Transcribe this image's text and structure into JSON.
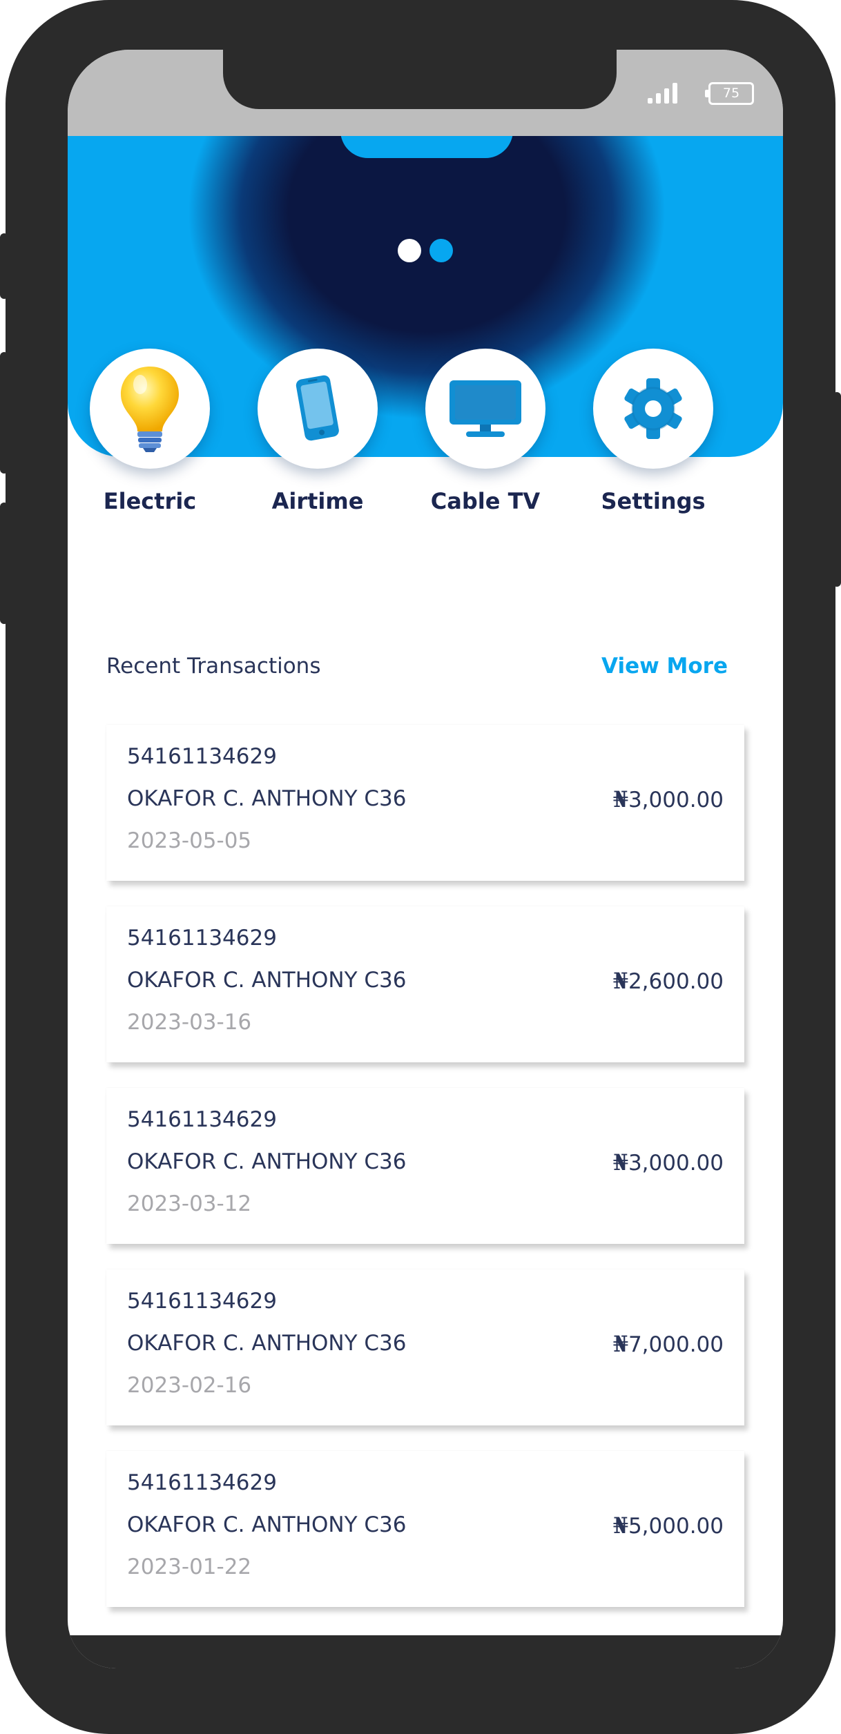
{
  "status_bar": {
    "battery_level": "75",
    "signal_bars": 4
  },
  "carousel": {
    "page_count": 2,
    "active_index": 1
  },
  "services": [
    {
      "label": "Electric",
      "icon": "lightbulb-icon"
    },
    {
      "label": "Airtime",
      "icon": "smartphone-icon"
    },
    {
      "label": "Cable TV",
      "icon": "tv-monitor-icon"
    },
    {
      "label": "Settings",
      "icon": "gear-icon"
    }
  ],
  "transactions_section": {
    "title": "Recent Transactions",
    "view_more_label": "View More"
  },
  "currency_symbol": "₦",
  "transactions": [
    {
      "account": "54161134629",
      "name": "OKAFOR C. ANTHONY C36",
      "date": "2023-05-05",
      "amount": "3,000.00"
    },
    {
      "account": "54161134629",
      "name": "OKAFOR C. ANTHONY C36",
      "date": "2023-03-16",
      "amount": "2,600.00"
    },
    {
      "account": "54161134629",
      "name": "OKAFOR C. ANTHONY C36",
      "date": "2023-03-12",
      "amount": "3,000.00"
    },
    {
      "account": "54161134629",
      "name": "OKAFOR C. ANTHONY C36",
      "date": "2023-02-16",
      "amount": "7,000.00"
    },
    {
      "account": "54161134629",
      "name": "OKAFOR C. ANTHONY C36",
      "date": "2023-01-22",
      "amount": "5,000.00"
    }
  ],
  "colors": {
    "primary": "#07a7f0",
    "navy": "#0b1742",
    "text_dark": "#2a3559",
    "text_muted": "#a7a7ab",
    "link": "#08a6ef"
  }
}
